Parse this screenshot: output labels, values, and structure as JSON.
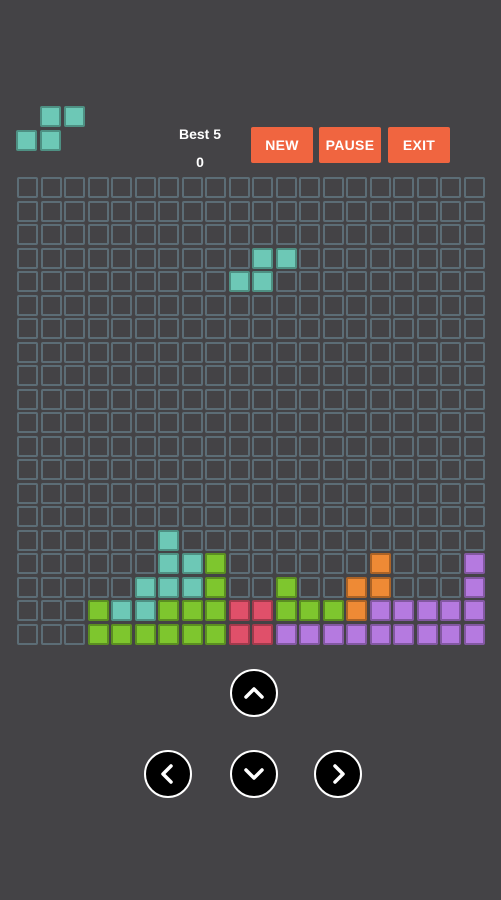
{
  "header": {
    "best_text": "Best 5",
    "score": "0",
    "new_label": "NEW",
    "pause_label": "PAUSE",
    "exit_label": "EXIT",
    "button_color": "#f06540"
  },
  "next_piece": {
    "shape": "S",
    "color": "#6dc8b6",
    "cells": [
      [
        0,
        1
      ],
      [
        0,
        2
      ],
      [
        1,
        0
      ],
      [
        1,
        1
      ]
    ]
  },
  "board": {
    "cols": 20,
    "rows": 20,
    "empty_color": "#5c6d76",
    "palette": {
      "teal": "#6dc8b6",
      "green": "#7ec62e",
      "red": "#e0506a",
      "orange": "#ee8a35",
      "purple": "#b57ae0"
    },
    "filled": [
      {
        "r": 3,
        "c": 10,
        "color": "teal"
      },
      {
        "r": 3,
        "c": 11,
        "color": "teal"
      },
      {
        "r": 4,
        "c": 9,
        "color": "teal"
      },
      {
        "r": 4,
        "c": 10,
        "color": "teal"
      },
      {
        "r": 15,
        "c": 6,
        "color": "teal"
      },
      {
        "r": 16,
        "c": 6,
        "color": "teal"
      },
      {
        "r": 16,
        "c": 7,
        "color": "teal"
      },
      {
        "r": 16,
        "c": 8,
        "color": "green"
      },
      {
        "r": 16,
        "c": 15,
        "color": "orange"
      },
      {
        "r": 16,
        "c": 19,
        "color": "purple"
      },
      {
        "r": 17,
        "c": 5,
        "color": "teal"
      },
      {
        "r": 17,
        "c": 6,
        "color": "teal"
      },
      {
        "r": 17,
        "c": 7,
        "color": "teal"
      },
      {
        "r": 17,
        "c": 8,
        "color": "green"
      },
      {
        "r": 17,
        "c": 11,
        "color": "green"
      },
      {
        "r": 17,
        "c": 14,
        "color": "orange"
      },
      {
        "r": 17,
        "c": 15,
        "color": "orange"
      },
      {
        "r": 17,
        "c": 19,
        "color": "purple"
      },
      {
        "r": 18,
        "c": 3,
        "color": "green"
      },
      {
        "r": 18,
        "c": 4,
        "color": "teal"
      },
      {
        "r": 18,
        "c": 5,
        "color": "teal"
      },
      {
        "r": 18,
        "c": 6,
        "color": "green"
      },
      {
        "r": 18,
        "c": 7,
        "color": "green"
      },
      {
        "r": 18,
        "c": 8,
        "color": "green"
      },
      {
        "r": 18,
        "c": 9,
        "color": "red"
      },
      {
        "r": 18,
        "c": 10,
        "color": "red"
      },
      {
        "r": 18,
        "c": 11,
        "color": "green"
      },
      {
        "r": 18,
        "c": 12,
        "color": "green"
      },
      {
        "r": 18,
        "c": 13,
        "color": "green"
      },
      {
        "r": 18,
        "c": 14,
        "color": "orange"
      },
      {
        "r": 18,
        "c": 15,
        "color": "purple"
      },
      {
        "r": 18,
        "c": 16,
        "color": "purple"
      },
      {
        "r": 18,
        "c": 17,
        "color": "purple"
      },
      {
        "r": 18,
        "c": 18,
        "color": "purple"
      },
      {
        "r": 18,
        "c": 19,
        "color": "purple"
      },
      {
        "r": 19,
        "c": 3,
        "color": "green"
      },
      {
        "r": 19,
        "c": 4,
        "color": "green"
      },
      {
        "r": 19,
        "c": 5,
        "color": "green"
      },
      {
        "r": 19,
        "c": 6,
        "color": "green"
      },
      {
        "r": 19,
        "c": 7,
        "color": "green"
      },
      {
        "r": 19,
        "c": 8,
        "color": "green"
      },
      {
        "r": 19,
        "c": 9,
        "color": "red"
      },
      {
        "r": 19,
        "c": 10,
        "color": "red"
      },
      {
        "r": 19,
        "c": 11,
        "color": "purple"
      },
      {
        "r": 19,
        "c": 12,
        "color": "purple"
      },
      {
        "r": 19,
        "c": 13,
        "color": "purple"
      },
      {
        "r": 19,
        "c": 14,
        "color": "purple"
      },
      {
        "r": 19,
        "c": 15,
        "color": "purple"
      },
      {
        "r": 19,
        "c": 16,
        "color": "purple"
      },
      {
        "r": 19,
        "c": 17,
        "color": "purple"
      },
      {
        "r": 19,
        "c": 18,
        "color": "purple"
      },
      {
        "r": 19,
        "c": 19,
        "color": "purple"
      }
    ]
  },
  "controls": {
    "up_icon": "chevron-up-icon",
    "left_icon": "chevron-left-icon",
    "down_icon": "chevron-down-icon",
    "right_icon": "chevron-right-icon"
  }
}
